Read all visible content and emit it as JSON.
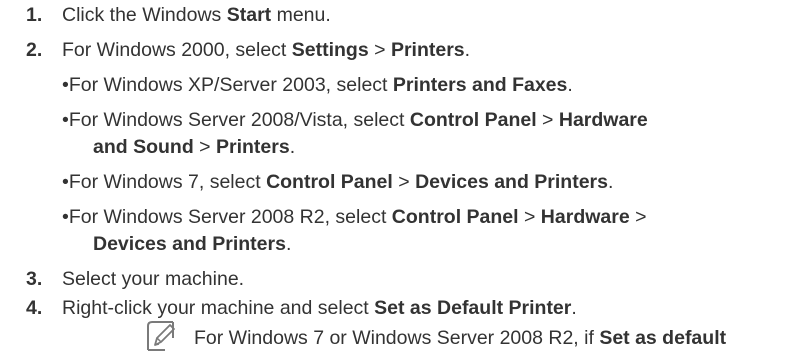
{
  "steps": [
    {
      "num": "1.",
      "parts": [
        "Click the Windows ",
        "Start",
        " menu."
      ]
    },
    {
      "num": "2.",
      "parts": [
        "For Windows 2000, select ",
        "Settings",
        " > ",
        "Printers",
        "."
      ],
      "subs": [
        {
          "bullet": "•",
          "parts": [
            "For Windows XP/Server 2003, select ",
            "Printers and Faxes",
            "."
          ]
        },
        {
          "bullet": "•",
          "parts": [
            "For Windows Server 2008/Vista, select ",
            "Control Panel",
            " > ",
            "Hardware"
          ],
          "cont": [
            "and Sound",
            " > ",
            "Printers",
            "."
          ]
        },
        {
          "bullet": "•",
          "parts": [
            "For Windows 7, select ",
            "Control Panel",
            " > ",
            "Devices and Printers",
            "."
          ]
        },
        {
          "bullet": "•",
          "parts": [
            "For Windows Server 2008 R2, select ",
            "Control Panel",
            " > ",
            "Hardware",
            " >"
          ],
          "cont": [
            "Devices and Printers",
            "."
          ]
        }
      ]
    },
    {
      "num": "3.",
      "parts": [
        "Select your machine."
      ]
    },
    {
      "num": "4.",
      "parts": [
        "Right-click your machine and select ",
        "Set as Default Printer",
        "."
      ]
    }
  ],
  "note": {
    "icon": "note-pencil-icon",
    "parts": [
      "For Windows 7 or Windows Server 2008 R2, if ",
      "Set as default"
    ]
  }
}
